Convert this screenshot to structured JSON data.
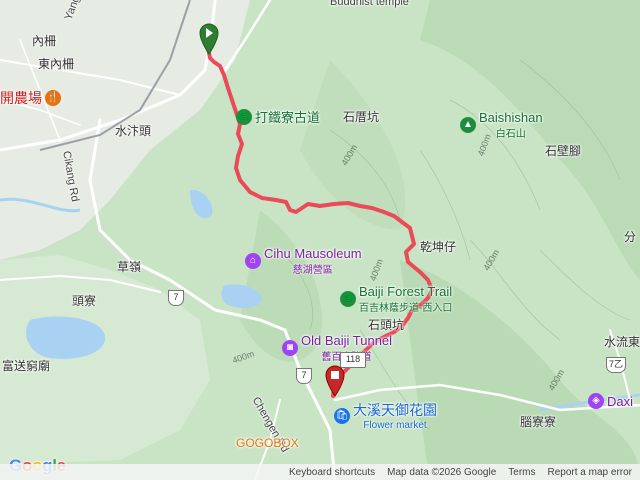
{
  "places": {
    "top_road_partial": "Yang",
    "temple_partial": "Buddhist temple",
    "neiche": "內柵",
    "dongneiche": "東內柵",
    "farm": "開農場",
    "shuiqiantou": "水汴頭",
    "cikang_rd": "Cikang Rd",
    "datieliao": "打鐵寮古道",
    "shicuokeng": "石厝坑",
    "baishishan_en": "Baishishan",
    "baishishan_zh": "白石山",
    "shibiliao": "石壁腳",
    "fen_partial": "分",
    "caoling": "草嶺",
    "touliao": "頭寮",
    "qiankunzi": "乾坤仔",
    "cihu_en": "Cihu Mausoleum",
    "cihu_zh": "慈湖營區",
    "baiji_trail_en": "Baiji Forest Trail",
    "baiji_trail_zh": "百吉林蔭步道-西入口",
    "shijiakeng": "石頭坑",
    "tunnel_en": "Old Baiji Tunnel",
    "tunnel_zh": "舊百吉隧道",
    "fusongqiao": "富送窮廟",
    "chengen_rd": "Chengen Rd",
    "tianyu_zh": "大溪天御花園",
    "tianyu_en": "Flower market",
    "naoliao": "腦寮寮",
    "shuiliu": "水流東",
    "daxi_partial": "Daxi",
    "gogobox_partial": "GOGOBOX",
    "route7a": "7",
    "route7b": "7",
    "route7c": "7乙",
    "route118": "118"
  },
  "contours": {
    "c1": "400m",
    "c2": "400m",
    "c3": "400m",
    "c4": "400m",
    "c5": "400m",
    "c6": "400m"
  },
  "markers": {
    "start": "start-pin",
    "end": "end-pin"
  },
  "route": {
    "color": "#ea4a5a"
  },
  "footer": {
    "shortcuts": "Keyboard shortcuts",
    "mapdata": "Map data ©2026 Google",
    "terms": "Terms",
    "report": "Report a map error"
  },
  "logo": {
    "g1": "G",
    "o1": "o",
    "o2": "o",
    "g2": "g",
    "l": "l",
    "e": "e"
  },
  "colors": {
    "forest": "#c6e2c2",
    "water": "#a9d2f2",
    "road": "#ffffff",
    "urban": "#e8eaed"
  }
}
